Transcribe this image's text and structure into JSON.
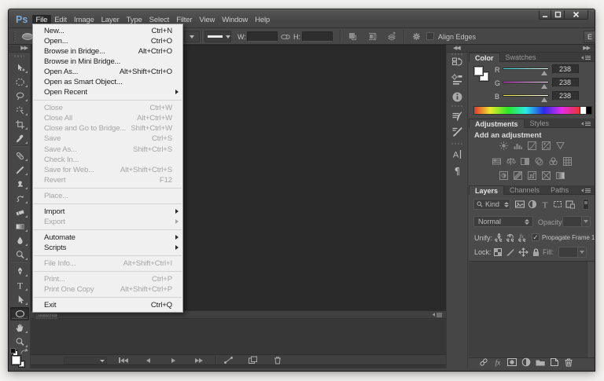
{
  "app": {
    "logo_text": "Ps",
    "logo_color": "#7db2e4",
    "theme_colors": {
      "titlebar": "#4a4a4a",
      "panel_background": "#464646",
      "canvas": "#2a2a2a",
      "menu_popup_background": "#f0f0f0",
      "menu_text": "#1c1c1c",
      "menu_disabled_text": "#a5a5a5"
    }
  },
  "titlebar": {
    "menus": [
      {
        "label": "File",
        "active": true
      },
      {
        "label": "Edit",
        "active": false
      },
      {
        "label": "Image",
        "active": false
      },
      {
        "label": "Layer",
        "active": false
      },
      {
        "label": "Type",
        "active": false
      },
      {
        "label": "Select",
        "active": false
      },
      {
        "label": "Filter",
        "active": false
      },
      {
        "label": "View",
        "active": false
      },
      {
        "label": "Window",
        "active": false
      },
      {
        "label": "Help",
        "active": false
      }
    ],
    "window_controls": [
      "minimize",
      "maximize",
      "close"
    ]
  },
  "file_menu": {
    "items": [
      {
        "label": "New...",
        "shortcut": "Ctrl+N",
        "enabled": true
      },
      {
        "label": "Open...",
        "shortcut": "Ctrl+O",
        "enabled": true
      },
      {
        "label": "Browse in Bridge...",
        "shortcut": "Alt+Ctrl+O",
        "enabled": true
      },
      {
        "label": "Browse in Mini Bridge...",
        "shortcut": "",
        "enabled": true
      },
      {
        "label": "Open As...",
        "shortcut": "Alt+Shift+Ctrl+O",
        "enabled": true
      },
      {
        "label": "Open as Smart Object...",
        "shortcut": "",
        "enabled": true
      },
      {
        "label": "Open Recent",
        "shortcut": "",
        "enabled": true,
        "submenu": true
      },
      {
        "separator": true
      },
      {
        "label": "Close",
        "shortcut": "Ctrl+W",
        "enabled": false
      },
      {
        "label": "Close All",
        "shortcut": "Alt+Ctrl+W",
        "enabled": false
      },
      {
        "label": "Close and Go to Bridge...",
        "shortcut": "Shift+Ctrl+W",
        "enabled": false
      },
      {
        "label": "Save",
        "shortcut": "Ctrl+S",
        "enabled": false
      },
      {
        "label": "Save As...",
        "shortcut": "Shift+Ctrl+S",
        "enabled": false
      },
      {
        "label": "Check In...",
        "shortcut": "",
        "enabled": false
      },
      {
        "label": "Save for Web...",
        "shortcut": "Alt+Shift+Ctrl+S",
        "enabled": false
      },
      {
        "label": "Revert",
        "shortcut": "F12",
        "enabled": false
      },
      {
        "separator": true
      },
      {
        "label": "Place...",
        "shortcut": "",
        "enabled": false
      },
      {
        "separator": true
      },
      {
        "label": "Import",
        "shortcut": "",
        "enabled": true,
        "submenu": true
      },
      {
        "label": "Export",
        "shortcut": "",
        "enabled": false,
        "submenu": true
      },
      {
        "separator": true
      },
      {
        "label": "Automate",
        "shortcut": "",
        "enabled": true,
        "submenu": true
      },
      {
        "label": "Scripts",
        "shortcut": "",
        "enabled": true,
        "submenu": true
      },
      {
        "separator": true
      },
      {
        "label": "File Info...",
        "shortcut": "Alt+Shift+Ctrl+I",
        "enabled": false
      },
      {
        "separator": true
      },
      {
        "label": "Print...",
        "shortcut": "Ctrl+P",
        "enabled": false
      },
      {
        "label": "Print One Copy",
        "shortcut": "Alt+Shift+Ctrl+P",
        "enabled": false
      },
      {
        "separator": true
      },
      {
        "label": "Exit",
        "shortcut": "Ctrl+Q",
        "enabled": true
      }
    ]
  },
  "options_bar": {
    "w_label": "W:",
    "w_value": "",
    "h_label": "H:",
    "h_value": "",
    "align_edges_label": "Align Edges",
    "align_edges_checked": false,
    "workspace_button_label": "E",
    "icons": [
      "tool-preset-ellipse",
      "dropdown-caret",
      "stroke-preview",
      "link-dimensions",
      "path-operations",
      "path-alignment",
      "path-arrange",
      "gear",
      "align-edges-checkbox"
    ]
  },
  "toolbar": {
    "tools": [
      {
        "name": "move",
        "selected": false
      },
      {
        "name": "elliptical-marquee",
        "selected": false
      },
      {
        "name": "lasso",
        "selected": false
      },
      {
        "name": "magic-wand",
        "selected": false
      },
      {
        "name": "crop",
        "selected": false
      },
      {
        "name": "eyedropper",
        "selected": false
      },
      {
        "name": "healing-brush",
        "selected": false,
        "newGroup": true
      },
      {
        "name": "brush",
        "selected": false
      },
      {
        "name": "clone-stamp",
        "selected": false
      },
      {
        "name": "history-brush",
        "selected": false
      },
      {
        "name": "eraser",
        "selected": false
      },
      {
        "name": "gradient",
        "selected": false
      },
      {
        "name": "blur",
        "selected": false
      },
      {
        "name": "dodge",
        "selected": false
      },
      {
        "name": "pen",
        "selected": false,
        "newGroup": true
      },
      {
        "name": "type",
        "selected": false
      },
      {
        "name": "path-selection",
        "selected": false
      },
      {
        "name": "ellipse-shape",
        "selected": true
      },
      {
        "name": "hand",
        "selected": false,
        "newGroup": true
      },
      {
        "name": "zoom",
        "selected": false
      }
    ],
    "color_wells": [
      "default-colors",
      "swap-colors",
      "foreground-color-white",
      "background-color-white"
    ]
  },
  "dock_strip": {
    "icons": [
      {
        "name": "history",
        "group": 1
      },
      {
        "name": "properties",
        "group": 1
      },
      {
        "name": "info",
        "group": 1
      },
      {
        "name": "brush-presets",
        "group": 2
      },
      {
        "name": "brush-panel",
        "group": 2
      },
      {
        "name": "character",
        "group": 3
      },
      {
        "name": "paragraph",
        "group": 3
      }
    ]
  },
  "color_panel": {
    "tabs": [
      {
        "label": "Color",
        "active": true
      },
      {
        "label": "Swatches",
        "active": false
      }
    ],
    "channels": [
      {
        "label": "R",
        "value": "238"
      },
      {
        "label": "G",
        "value": "238"
      },
      {
        "label": "B",
        "value": "238"
      }
    ],
    "slider_gradients": {
      "R": [
        "#29e0e0",
        "#ffffff"
      ],
      "G": [
        "#e829e8",
        "#ffffff"
      ],
      "B": [
        "#e8e829",
        "#ffffff"
      ]
    }
  },
  "adjustments_panel": {
    "tabs": [
      {
        "label": "Adjustments",
        "active": true
      },
      {
        "label": "Styles",
        "active": false
      }
    ],
    "heading": "Add an adjustment",
    "icon_rows": [
      [
        "brightness-contrast",
        "levels",
        "curves",
        "exposure",
        "vibrance"
      ],
      [
        "hue-saturation",
        "color-balance",
        "black-white",
        "photo-filter",
        "channel-mixer",
        "color-lookup"
      ],
      [
        "invert",
        "posterize",
        "threshold",
        "selective-color",
        "gradient-map"
      ]
    ]
  },
  "layers_panel": {
    "tabs": [
      {
        "label": "Layers",
        "active": true
      },
      {
        "label": "Channels",
        "active": false
      },
      {
        "label": "Paths",
        "active": false
      }
    ],
    "filter_label": "Kind",
    "filter_icons": [
      "pixel-layers-filter",
      "adjustment-layers-filter",
      "type-layers-filter",
      "shape-layers-filter",
      "smart-object-filter"
    ],
    "blend_mode": "Normal",
    "opacity_label": "Opacity:",
    "opacity_value": "",
    "unify_label": "Unify:",
    "unify_icons": [
      "unify-position",
      "unify-visibility",
      "unify-style"
    ],
    "propagate_label": "Propagate Frame 1",
    "propagate_checked": true,
    "lock_label": "Lock:",
    "lock_icons": [
      "lock-transparency",
      "lock-pixels",
      "lock-position",
      "lock-all"
    ],
    "fill_label": "Fill:",
    "fill_value": "",
    "bottom_icons": [
      "link-layers",
      "layer-style",
      "layer-mask",
      "new-adjustment-layer",
      "new-group",
      "new-layer",
      "delete-layer"
    ]
  },
  "timeline_panel": {
    "tab_label": "ANIMATION (FRAMES)",
    "controls": [
      "loop-dropdown",
      "first-frame",
      "previous-frame",
      "play",
      "next-frame",
      "tween",
      "duplicate-frame",
      "delete-frame"
    ]
  }
}
